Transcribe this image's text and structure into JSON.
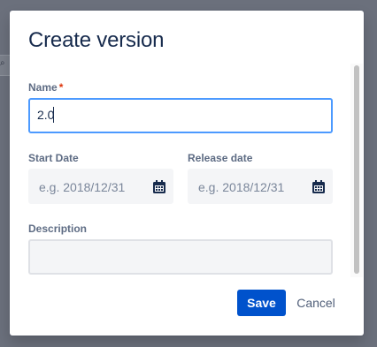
{
  "dialog": {
    "title": "Create version",
    "fields": {
      "name": {
        "label": "Name",
        "required_marker": "*",
        "value": "2.0"
      },
      "start_date": {
        "label": "Start Date",
        "placeholder": "e.g. 2018/12/31",
        "icon": "calendar-icon"
      },
      "release_date": {
        "label": "Release date",
        "placeholder": "e.g. 2018/12/31",
        "icon": "calendar-icon"
      },
      "description": {
        "label": "Description",
        "value": ""
      }
    },
    "actions": {
      "save_label": "Save",
      "cancel_label": "Cancel"
    }
  },
  "colors": {
    "primary_button": "#0052cc",
    "focus_border": "#4c9aff",
    "required_marker": "#de350b",
    "title_text": "#172b4d"
  }
}
